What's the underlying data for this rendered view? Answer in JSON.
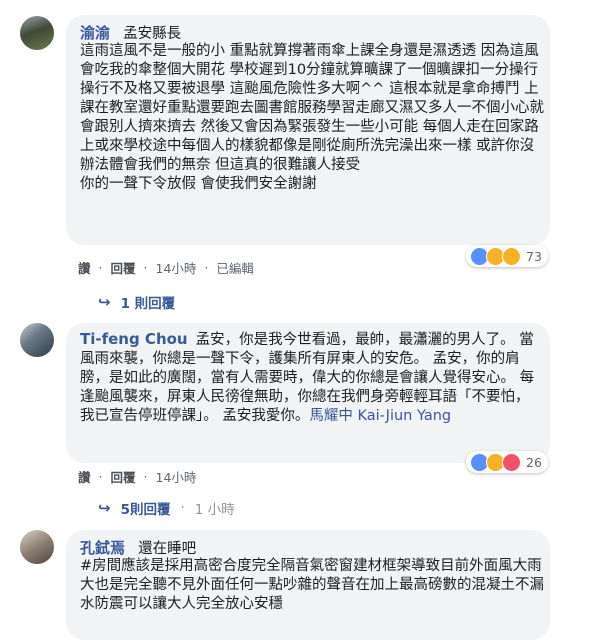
{
  "comments": [
    {
      "author": "渝渝",
      "location": "孟安縣長",
      "text": "這雨這風不是一般的小 重點就算撐著雨傘上課全身還是濕透透 因為這風會吃我的傘整個大開花 學校遲到10分鐘就算曠課了一個曠課扣一分操行 操行不及格又要被退學 這颱風危險性多大啊^^ 這根本就是拿命搏鬥 上課在教室還好重點還要跑去圖書館服務學習走廊又濕又多人一不個小心就會跟別人擠來擠去 然後又會因為緊張發生一些小可能 每個人走在回家路上或來學校途中每個人的樣貌都像是剛從廁所洗完澡出來一樣 或許你沒辦法體會我們的無奈 但這真的很難讓人接受\n你的一聲下令放假 會使我們安全謝謝",
      "actions": [
        "讚",
        "回覆",
        "14小時",
        "已編輯"
      ],
      "reaction_count": "73",
      "reactions": [
        "like-icon",
        "sad-icon",
        "wow-icon"
      ],
      "replies_label": "1 則回覆"
    },
    {
      "author": "Ti-feng Chou",
      "text_before": "孟安，你是我今世看過，最帥，最瀟灑的男人了。 當風雨來襲，你總是一聲下令，護集所有屏東人的安危。 孟安，你的肩膀，是如此的廣闊，當有人需要時，偉大的你總是會讓人覺得安心。 每逢颱風襲來，屏東人民徬徨無助，你總在我們身旁輕輕耳語「不要怕，我已宣告停班停課」。 孟安我愛你。",
      "mention": "馬耀中 Kai-Jiun Yang",
      "actions": [
        "讚",
        "回覆",
        "14小時"
      ],
      "reaction_count": "26",
      "reactions": [
        "like-icon",
        "haha-icon",
        "love-icon"
      ],
      "replies_label": "5則回覆",
      "replies_time": "1 小時"
    },
    {
      "author": "孔鉽焉",
      "first_line": "還在睡吧",
      "text": "#房間應該是採用高密合度完全隔音氣密窗建材框架導致目前外面風大雨大也是完全聽不見外面任何一點吵雜的聲音在加上最高磅數的混凝土不漏水防震可以讓大人完全放心安穩"
    }
  ]
}
